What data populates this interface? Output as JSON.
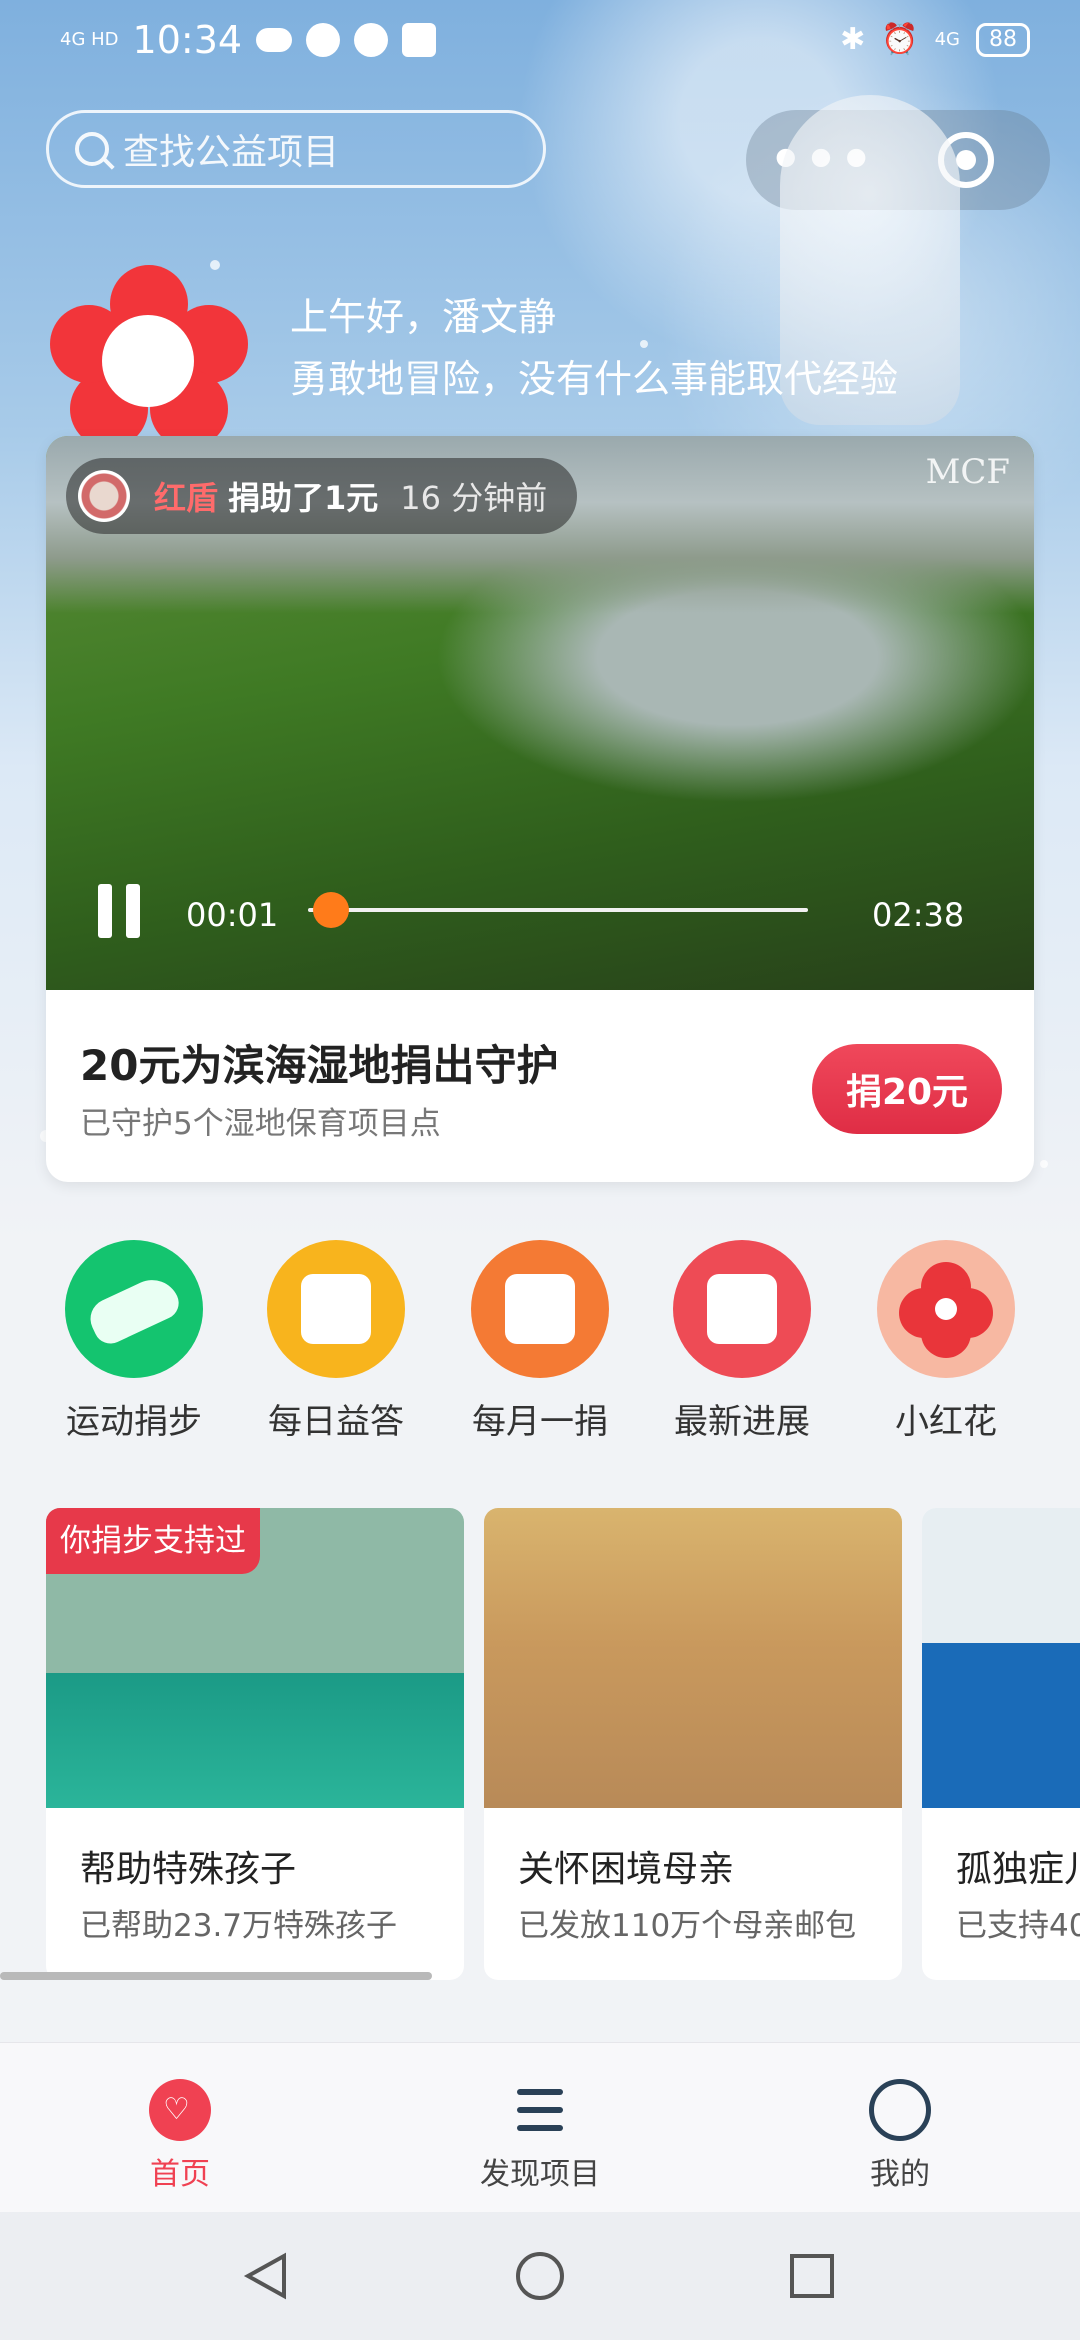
{
  "status_bar": {
    "network": "4G HD",
    "time": "10:34",
    "battery": "88"
  },
  "search": {
    "placeholder": "查找公益项目"
  },
  "greeting": {
    "line1": "上午好，潘文静",
    "line2": "勇敢地冒险，没有什么事能取代经验"
  },
  "video_card": {
    "donor_name": "红盾",
    "donor_action": "捐助了1元",
    "donor_time": "16 分钟前",
    "logo_text": "MCF",
    "current_time": "00:01",
    "duration": "02:38",
    "progress_fraction": 0.01,
    "title": "20元为滨海湿地捐出守护",
    "subtitle": "已守护5个湿地保育项目点",
    "donate_button": "捐20元"
  },
  "quick_actions": [
    {
      "label": "运动捐步",
      "icon": "sneaker-icon",
      "color": "#14c46f"
    },
    {
      "label": "每日益答",
      "icon": "quiz-card-icon",
      "color": "#f8b41d"
    },
    {
      "label": "每月一捐",
      "icon": "calendar-heart-icon",
      "color": "#f47a34"
    },
    {
      "label": "最新进展",
      "icon": "inbox-heart-icon",
      "color": "#ee4b55"
    },
    {
      "label": "小红花",
      "icon": "red-flower-icon",
      "color": "#f7b8a2"
    }
  ],
  "projects": [
    {
      "ribbon": "你捐步支持过",
      "title": "帮助特殊孩子",
      "subtitle": "已帮助23.7万特殊孩子"
    },
    {
      "title": "关怀困境母亲",
      "subtitle": "已发放110万个母亲邮包"
    },
    {
      "title": "孤独症儿",
      "subtitle": "已支持40"
    }
  ],
  "tabbar": [
    {
      "label": "首页",
      "active": true
    },
    {
      "label": "发现项目",
      "active": false
    },
    {
      "label": "我的",
      "active": false
    }
  ],
  "colors": {
    "accent": "#f04152",
    "progress_knob": "#ff7b1a"
  }
}
